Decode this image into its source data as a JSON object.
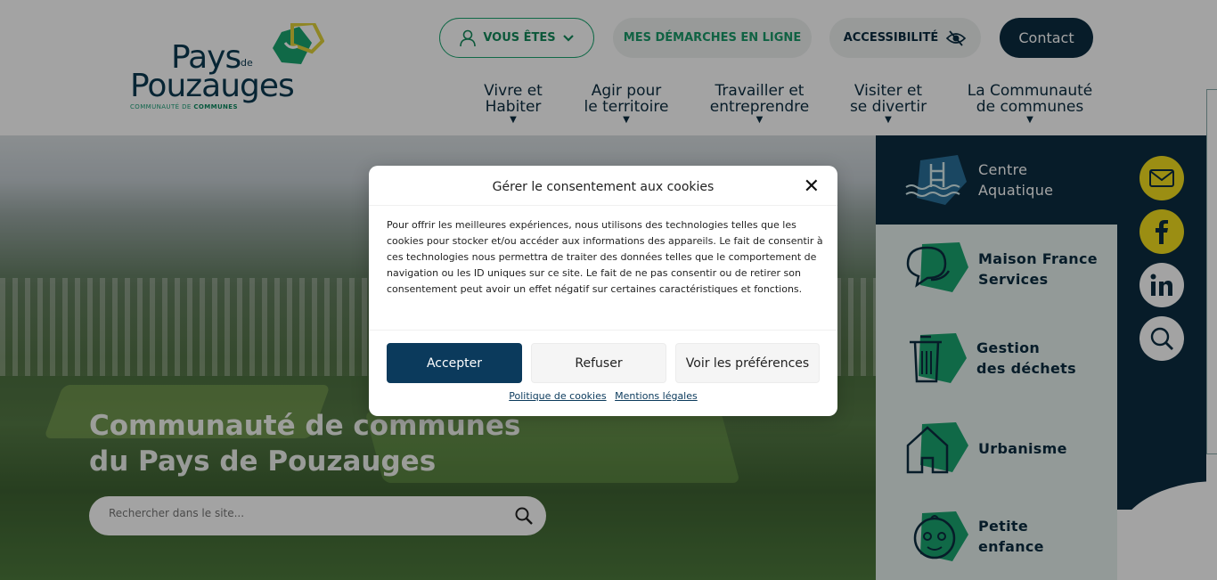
{
  "header": {
    "logo": {
      "line1": "Pays",
      "de": "de",
      "line2": "Pouzauges",
      "sub_prefix": "COMMUNAUTÉ DE",
      "sub_bold": "COMMUNES"
    },
    "vous_etes": "VOUS ÊTES",
    "demarches": "MES DÉMARCHES EN LIGNE",
    "accessibilite": "ACCESSIBILITÉ",
    "contact": "Contact",
    "nav": [
      {
        "l1": "Vivre et",
        "l2": "Habiter"
      },
      {
        "l1": "Agir pour",
        "l2": "le territoire"
      },
      {
        "l1": "Travailler et",
        "l2": "entreprendre"
      },
      {
        "l1": "Visiter et",
        "l2": "se divertir"
      },
      {
        "l1": "La Communauté",
        "l2": "de communes"
      }
    ]
  },
  "hero": {
    "title_l1": "Communauté de communes",
    "title_l2": "du Pays de Pouzauges",
    "search_placeholder": "Rechercher dans le site..."
  },
  "side": [
    {
      "l1": "Centre",
      "l2": "Aquatique",
      "icon": "pool-icon"
    },
    {
      "l1": "Maison France",
      "l2": "Services",
      "icon": "chat-bubbles-icon"
    },
    {
      "l1": "Gestion",
      "l2": "des déchets",
      "icon": "trash-bin-icon"
    },
    {
      "l1": "Urbanisme",
      "l2": "",
      "icon": "house-icon"
    },
    {
      "l1": "Petite",
      "l2": "enfance",
      "icon": "baby-face-icon"
    }
  ],
  "cookie": {
    "title": "Gérer le consentement aux cookies",
    "text": "Pour offrir les meilleures expériences, nous utilisons des technologies telles que les cookies pour stocker et/ou accéder aux informations des appareils. Le fait de consentir à ces technologies nous permettra de traiter des données telles que le comportement de navigation ou les ID uniques sur ce site. Le fait de ne pas consentir ou de retirer son consentement peut avoir un effet négatif sur certaines caractéristiques et fonctions.",
    "accept": "Accepter",
    "refuse": "Refuser",
    "prefs": "Voir les préférences",
    "policy": "Politique de cookies",
    "legal": "Mentions légales",
    "close": "✕"
  },
  "colors": {
    "navy": "#0b2d40",
    "green": "#1aa56f",
    "yellow": "#f2df1e",
    "accept_bg": "#0b3a5c"
  }
}
